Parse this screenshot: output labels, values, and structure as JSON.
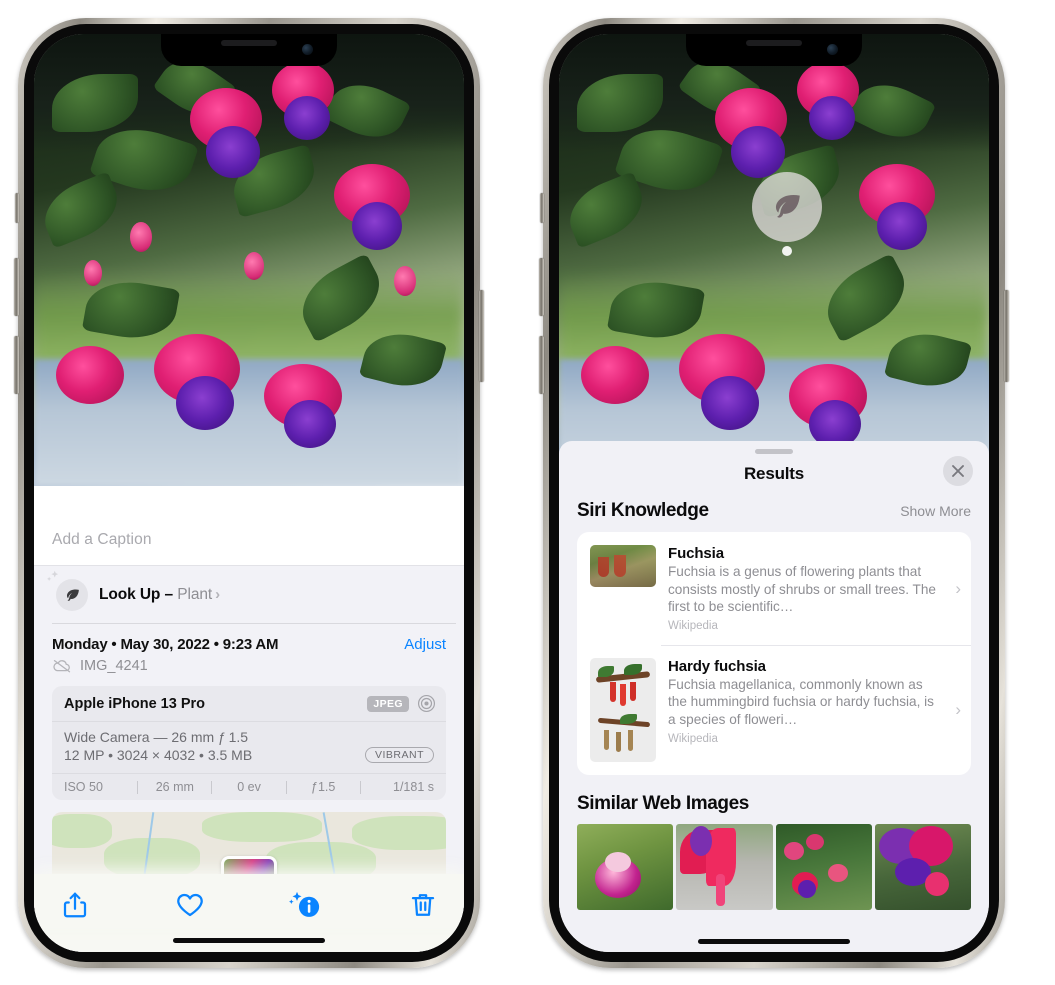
{
  "left_phone": {
    "caption_placeholder": "Add a Caption",
    "lookup": {
      "label": "Look Up – ",
      "subject": "Plant",
      "chevron": "›",
      "icon": "leaf-icon"
    },
    "metadata": {
      "date": "Monday • May 30, 2022 • 9:23 AM",
      "adjust_label": "Adjust",
      "filename": "IMG_4241",
      "cloud_icon": "cloud-slash-icon"
    },
    "exif": {
      "device": "Apple iPhone 13 Pro",
      "format_badge": "JPEG",
      "aperture_icon": "aperture-icon",
      "lens_line": "Wide Camera — 26 mm ƒ 1.5",
      "size_line": "12 MP • 3024 × 4032 • 3.5 MB",
      "style_badge": "VIBRANT",
      "stats": [
        "ISO 50",
        "26 mm",
        "0 ev",
        "ƒ1.5",
        "1/181 s"
      ]
    },
    "toolbar": [
      {
        "name": "share-icon",
        "label": "Share"
      },
      {
        "name": "heart-icon",
        "label": "Favorite"
      },
      {
        "name": "info-sparkle-icon",
        "label": "Info"
      },
      {
        "name": "trash-icon",
        "label": "Delete"
      }
    ]
  },
  "right_phone": {
    "badge": {
      "icon": "leaf-icon",
      "label": "Visual Look Up"
    },
    "sheet": {
      "title": "Results",
      "close_label": "✕"
    },
    "siri_knowledge": {
      "section_title": "Siri Knowledge",
      "show_more": "Show More",
      "items": [
        {
          "title": "Fuchsia",
          "description": "Fuchsia is a genus of flowering plants that consists mostly of shrubs or small trees. The first to be scientific…",
          "source": "Wikipedia",
          "chevron": "›"
        },
        {
          "title": "Hardy fuchsia",
          "description": "Fuchsia magellanica, commonly known as the hummingbird fuchsia or hardy fuchsia, is a species of floweri…",
          "source": "Wikipedia",
          "chevron": "›"
        }
      ]
    },
    "similar_web_images": {
      "section_title": "Similar Web Images",
      "count": 4
    }
  },
  "colors": {
    "accent_blue": "#0a84ff",
    "sheet_gray": "#f1f1f6",
    "card_white": "#ffffff",
    "secondary_text": "#8e8e93",
    "exif_card": "#e9e9ee"
  }
}
